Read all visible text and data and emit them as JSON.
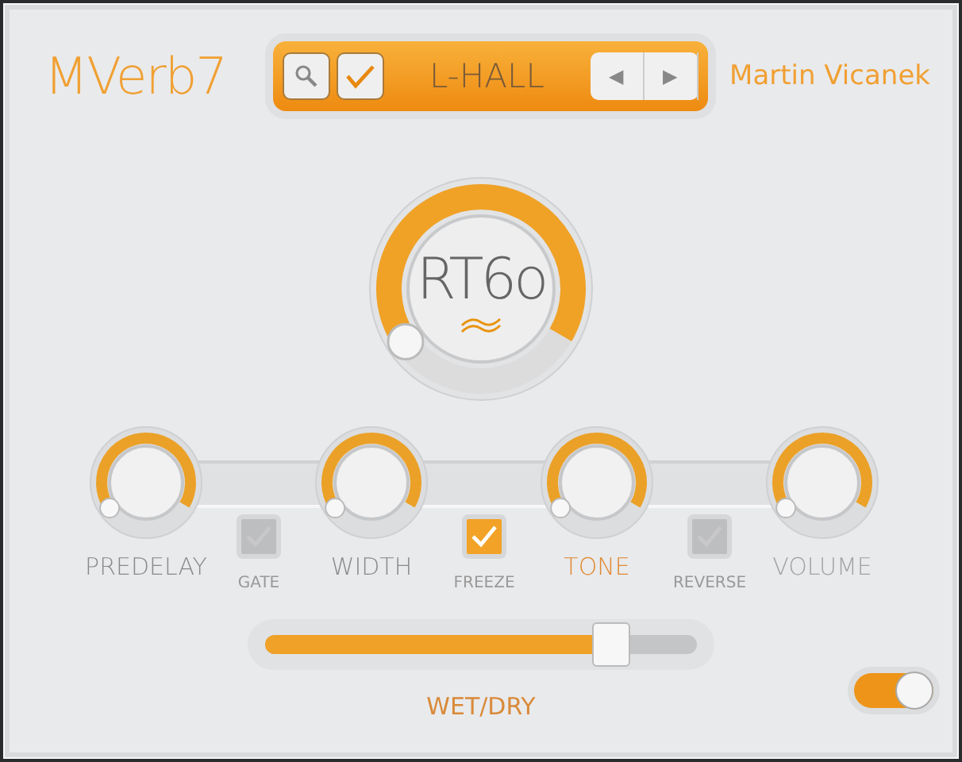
{
  "title": "MVerb7",
  "author": "Martin Vicanek",
  "preset": {
    "name": "L-HALL",
    "prev": "◀",
    "next": "▶"
  },
  "main_knob": {
    "label": "RT6o"
  },
  "knobs": [
    {
      "label": "PREDELAY",
      "selected": false,
      "disabled": false
    },
    {
      "label": "WIDTH",
      "selected": false,
      "disabled": false
    },
    {
      "label": "TONE",
      "selected": true,
      "disabled": false
    },
    {
      "label": "VOLUME",
      "selected": false,
      "disabled": true
    }
  ],
  "switches": [
    {
      "label": "GATE",
      "checked": false
    },
    {
      "label": "FREEZE",
      "checked": true
    },
    {
      "label": "REVERSE",
      "checked": false
    }
  ],
  "wet_dry": {
    "label": "WET/DRY",
    "level": 0.8
  },
  "power": {
    "on": true
  }
}
